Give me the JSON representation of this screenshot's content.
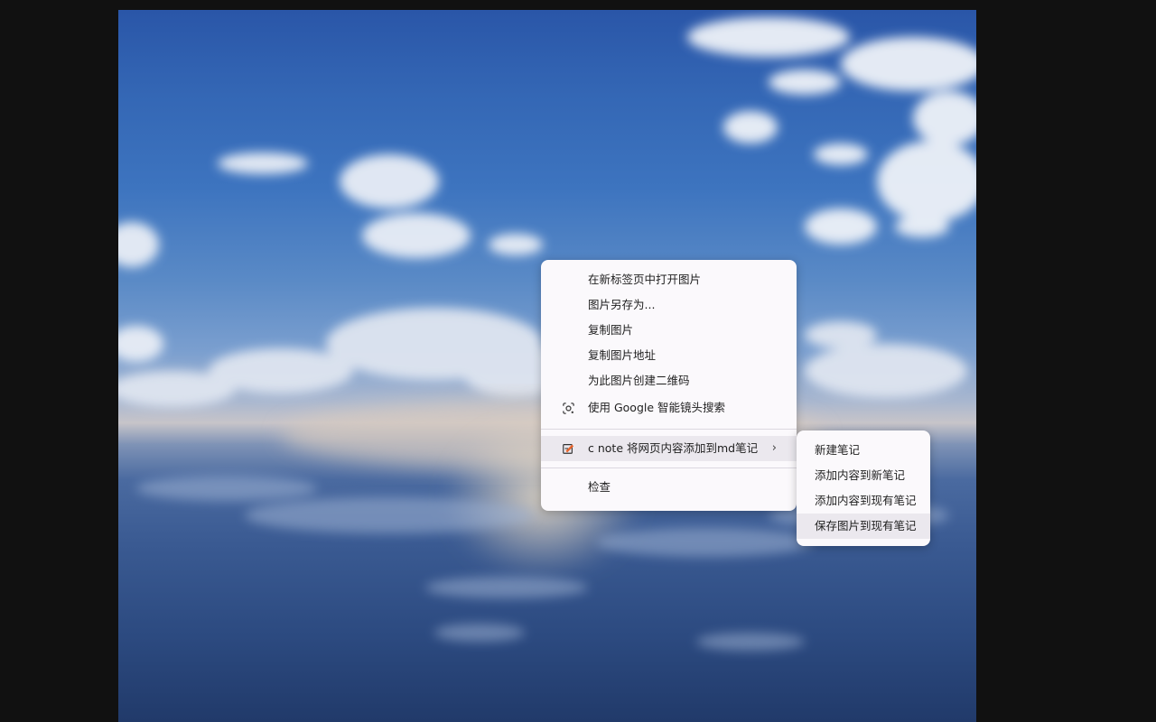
{
  "context_menu": {
    "items": [
      {
        "label": "在新标签页中打开图片"
      },
      {
        "label": "图片另存为..."
      },
      {
        "label": "复制图片"
      },
      {
        "label": "复制图片地址"
      },
      {
        "label": "为此图片创建二维码"
      },
      {
        "label": "使用 Google 智能镜头搜索",
        "icon": "lens-icon"
      }
    ],
    "extension_item": {
      "label": "c note 将网页内容添加到md笔记",
      "icon": "note-icon",
      "chevron": "›"
    },
    "inspect_item": {
      "label": "检查"
    }
  },
  "submenu": {
    "items": [
      {
        "label": "新建笔记"
      },
      {
        "label": "添加内容到新笔记"
      },
      {
        "label": "添加内容到现有笔记"
      },
      {
        "label": "保存图片到现有笔记"
      }
    ]
  },
  "colors": {
    "page_background": "#111111",
    "menu_background": "#fbf9fc",
    "menu_hover": "#ebe8ee",
    "menu_text": "#1f1f1f"
  }
}
